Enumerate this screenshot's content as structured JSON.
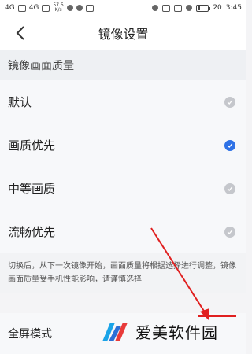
{
  "status_bar": {
    "left_indicators": [
      "4G",
      "4G"
    ],
    "speed_value": "57.5",
    "speed_unit": "K/s",
    "battery": "20",
    "time": "3:45"
  },
  "nav": {
    "title": "镜像设置"
  },
  "section": {
    "title": "镜像画面质量"
  },
  "options": [
    {
      "label": "默认",
      "selected": false
    },
    {
      "label": "画质优先",
      "selected": true
    },
    {
      "label": "中等画质",
      "selected": false
    },
    {
      "label": "流畅优先",
      "selected": false
    }
  ],
  "note": {
    "text": "切换后，从下一次镜像开始，画面质量将根据选择进行调整，镜像画面质量受手机性能影响，请谨慎选择"
  },
  "bottom_item": {
    "label": "全屏模式"
  },
  "watermark": {
    "text": "爱美软件园"
  },
  "colors": {
    "accent": "#2f72e6",
    "unchecked": "#c5c7cc",
    "arrow": "#e02020"
  }
}
